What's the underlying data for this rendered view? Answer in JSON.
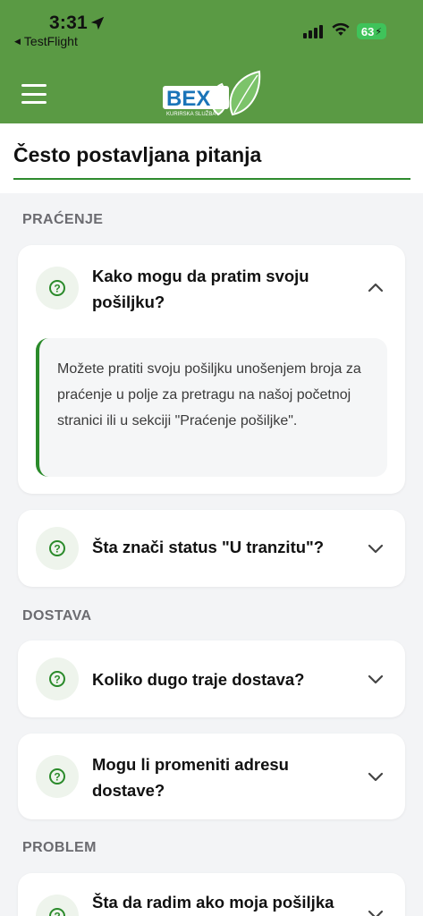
{
  "status_bar": {
    "time": "3:31",
    "back_app": "TestFlight",
    "battery": "63"
  },
  "header": {
    "logo_text": "BEX",
    "logo_sub": "KURIRSKA SLUŽBA",
    "page_title": "Često postavljana pitanja"
  },
  "sections": [
    {
      "title": "PRAĆENJE",
      "items": [
        {
          "question": "Kako mogu da pratim svoju pošiljku?",
          "answer": "Možete pratiti svoju pošiljku unošenjem broja za praćenje u polje za pretragu na našoj početnoj stranici ili u sekciji \"Praćenje pošiljke\".",
          "expanded": true
        },
        {
          "question": "Šta znači status \"U tranzitu\"?",
          "expanded": false
        }
      ]
    },
    {
      "title": "DOSTAVA",
      "items": [
        {
          "question": "Koliko dugo traje dostava?",
          "expanded": false
        },
        {
          "question": "Mogu li promeniti adresu dostave?",
          "expanded": false
        }
      ]
    },
    {
      "title": "PROBLEM",
      "items": [
        {
          "question": "Šta da radim ako moja pošiljka",
          "expanded": false
        }
      ]
    }
  ],
  "colors": {
    "brand_green": "#5a9a44",
    "accent_green": "#2a8a2a",
    "background": "#f3f4f6"
  },
  "icons": {
    "menu": "hamburger-icon",
    "question": "question-circle-icon",
    "expand": "chevron-down-icon",
    "collapse": "chevron-up-icon"
  }
}
